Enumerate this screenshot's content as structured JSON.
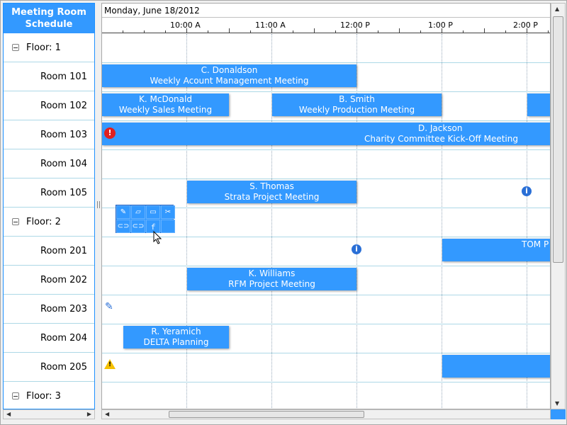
{
  "left_header": {
    "line1": "Meeting Room",
    "line2": "Schedule"
  },
  "rows": [
    {
      "type": "floor",
      "label": "Floor: 1"
    },
    {
      "type": "room",
      "label": "Room 101"
    },
    {
      "type": "room",
      "label": "Room 102"
    },
    {
      "type": "room",
      "label": "Room 103"
    },
    {
      "type": "room",
      "label": "Room 104"
    },
    {
      "type": "room",
      "label": "Room 105"
    },
    {
      "type": "floor",
      "label": "Floor: 2"
    },
    {
      "type": "room",
      "label": "Room 201"
    },
    {
      "type": "room",
      "label": "Room 202"
    },
    {
      "type": "room",
      "label": "Room 203"
    },
    {
      "type": "room",
      "label": "Room 204"
    },
    {
      "type": "room",
      "label": "Room 205"
    },
    {
      "type": "floor",
      "label": "Floor: 3"
    }
  ],
  "date_label": "Monday, June 18/2012",
  "time_labels": [
    "10:00 A",
    "11:00 A",
    "12:00 P",
    "1:00 P",
    "2:00 P"
  ],
  "events": [
    {
      "name": "C. Donaldson",
      "title": "Weekly Acount Management Meeting"
    },
    {
      "name": "K. McDonald",
      "title": "Weekly Sales Meeting"
    },
    {
      "name": "B. Smith",
      "title": "Weekly Production Meeting"
    },
    {
      "name": "",
      "title": ""
    },
    {
      "name": "D. Jackson",
      "title": "Charity Committee Kick-Off Meeting"
    },
    {
      "name": "S. Thomas",
      "title": "Strata Project Meeting"
    },
    {
      "name": "",
      "title": "TOM P"
    },
    {
      "name": "K. Williams",
      "title": "RFM Project Meeting"
    },
    {
      "name": "R. Yeramich",
      "title": "DELTA Planning"
    },
    {
      "name": "",
      "title": ""
    }
  ],
  "icons": {
    "error": "!",
    "info": "i",
    "warning": "!",
    "edit": "✎"
  },
  "colors": {
    "accent": "#3399ff",
    "error": "#e02020",
    "info": "#2a6fd6",
    "warning": "#f5c000"
  }
}
